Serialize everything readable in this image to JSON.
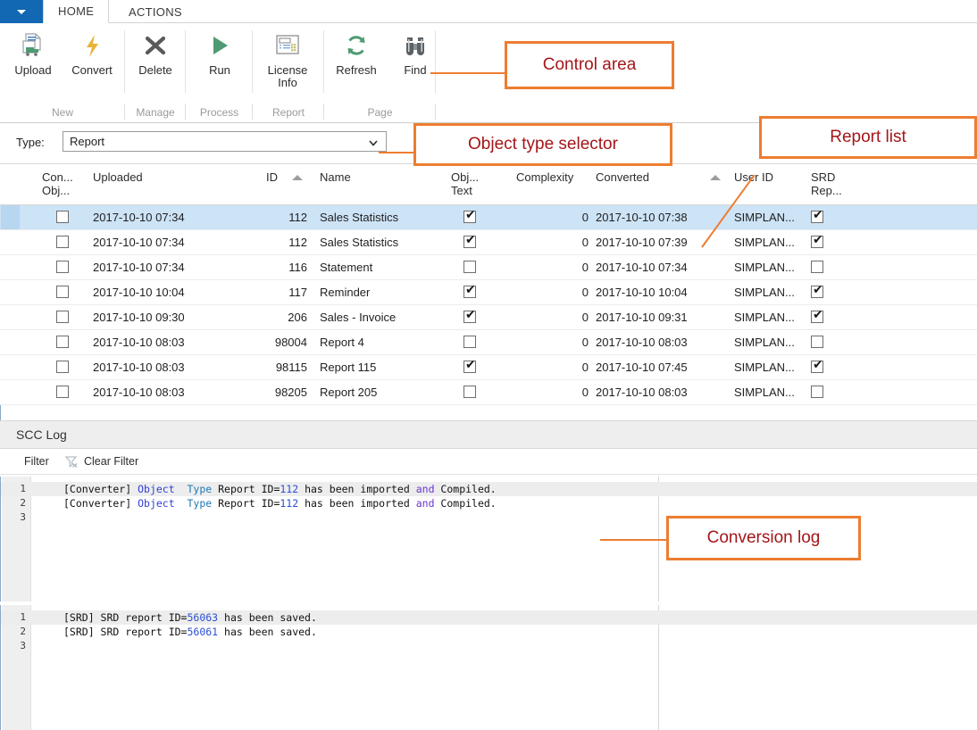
{
  "window": {
    "app_menu_icon": "chevron-down-icon",
    "tabs": [
      {
        "label": "HOME",
        "active": true
      },
      {
        "label": "ACTIONS",
        "active": false
      }
    ]
  },
  "ribbon": {
    "groups": [
      {
        "name": "New",
        "label": "New",
        "buttons": [
          {
            "label": "Upload",
            "icon": "upload-document-icon"
          },
          {
            "label": "Convert",
            "icon": "lightning-bolt-icon"
          }
        ]
      },
      {
        "name": "Manage",
        "label": "Manage",
        "buttons": [
          {
            "label": "Delete",
            "icon": "delete-x-icon"
          }
        ]
      },
      {
        "name": "Process",
        "label": "Process",
        "buttons": [
          {
            "label": "Run",
            "icon": "play-triangle-icon"
          }
        ]
      },
      {
        "name": "Report",
        "label": "Report",
        "buttons": [
          {
            "label": "License Info",
            "icon": "license-window-icon"
          }
        ]
      },
      {
        "name": "Page",
        "label": "Page",
        "buttons": [
          {
            "label": "Refresh",
            "icon": "refresh-circular-arrows-icon"
          },
          {
            "label": "Find",
            "icon": "binoculars-icon"
          }
        ]
      }
    ]
  },
  "type_selector": {
    "label": "Type:",
    "value": "Report",
    "placeholder": "Report",
    "dropdown_icon": "chevron-down-icon"
  },
  "grid": {
    "columns": [
      {
        "key": "converted_object",
        "header_line1": "Con...",
        "header_line2": "Obj..."
      },
      {
        "key": "uploaded",
        "header_line1": "Uploaded",
        "header_line2": ""
      },
      {
        "key": "id",
        "header_line1": "ID",
        "header_line2": "",
        "sorted": true
      },
      {
        "key": "name",
        "header_line1": "Name",
        "header_line2": ""
      },
      {
        "key": "object_text",
        "header_line1": "Obj...",
        "header_line2": "Text"
      },
      {
        "key": "complexity",
        "header_line1": "Complexity",
        "header_line2": ""
      },
      {
        "key": "converted",
        "header_line1": "Converted",
        "header_line2": "",
        "sorted": true
      },
      {
        "key": "user_id",
        "header_line1": "User ID",
        "header_line2": ""
      },
      {
        "key": "srd_report",
        "header_line1": "SRD",
        "header_line2": "Rep..."
      }
    ],
    "rows": [
      {
        "selected": true,
        "converted_object": false,
        "uploaded": "2017-10-10 07:34",
        "id": "112",
        "name": "Sales Statistics",
        "object_text": true,
        "complexity": "0",
        "converted": "2017-10-10 07:38",
        "user_id": "SIMPLAN...",
        "srd_report": true
      },
      {
        "selected": false,
        "converted_object": false,
        "uploaded": "2017-10-10 07:34",
        "id": "112",
        "name": "Sales Statistics",
        "object_text": true,
        "complexity": "0",
        "converted": "2017-10-10 07:39",
        "user_id": "SIMPLAN...",
        "srd_report": true
      },
      {
        "selected": false,
        "converted_object": false,
        "uploaded": "2017-10-10 07:34",
        "id": "116",
        "name": "Statement",
        "object_text": false,
        "complexity": "0",
        "converted": "2017-10-10 07:34",
        "user_id": "SIMPLAN...",
        "srd_report": false
      },
      {
        "selected": false,
        "converted_object": false,
        "uploaded": "2017-10-10 10:04",
        "id": "117",
        "name": "Reminder",
        "object_text": true,
        "complexity": "0",
        "converted": "2017-10-10 10:04",
        "user_id": "SIMPLAN...",
        "srd_report": true
      },
      {
        "selected": false,
        "converted_object": false,
        "uploaded": "2017-10-10 09:30",
        "id": "206",
        "name": "Sales - Invoice",
        "object_text": true,
        "complexity": "0",
        "converted": "2017-10-10 09:31",
        "user_id": "SIMPLAN...",
        "srd_report": true
      },
      {
        "selected": false,
        "converted_object": false,
        "uploaded": "2017-10-10 08:03",
        "id": "98004",
        "name": "Report 4",
        "object_text": false,
        "complexity": "0",
        "converted": "2017-10-10 08:03",
        "user_id": "SIMPLAN...",
        "srd_report": false
      },
      {
        "selected": false,
        "converted_object": false,
        "uploaded": "2017-10-10 08:03",
        "id": "98115",
        "name": "Report 115",
        "object_text": true,
        "complexity": "0",
        "converted": "2017-10-10 07:45",
        "user_id": "SIMPLAN...",
        "srd_report": true
      },
      {
        "selected": false,
        "converted_object": false,
        "uploaded": "2017-10-10 08:03",
        "id": "98205",
        "name": "Report 205",
        "object_text": false,
        "complexity": "0",
        "converted": "2017-10-10 08:03",
        "user_id": "SIMPLAN...",
        "srd_report": false
      }
    ]
  },
  "scc_log": {
    "title": "SCC Log",
    "filter_label": "Filter",
    "clear_filter_label": "Clear Filter",
    "clear_filter_icon": "funnel-clear-icon",
    "panels": [
      {
        "name": "converter-log",
        "lines": [
          {
            "number": "1",
            "segments": [
              {
                "t": "[Converter] ",
                "c": "plain"
              },
              {
                "t": "Object",
                "c": "kw-b"
              },
              {
                "t": "  ",
                "c": "plain"
              },
              {
                "t": "Type",
                "c": "kw-c"
              },
              {
                "t": " Report ID=",
                "c": "plain"
              },
              {
                "t": "112",
                "c": "kw-n"
              },
              {
                "t": " has been imported ",
                "c": "plain"
              },
              {
                "t": "and",
                "c": "kw-p"
              },
              {
                "t": " Compiled.",
                "c": "plain"
              }
            ]
          },
          {
            "number": "2",
            "segments": [
              {
                "t": "[Converter] ",
                "c": "plain"
              },
              {
                "t": "Object",
                "c": "kw-b"
              },
              {
                "t": "  ",
                "c": "plain"
              },
              {
                "t": "Type",
                "c": "kw-c"
              },
              {
                "t": " Report ID=",
                "c": "plain"
              },
              {
                "t": "112",
                "c": "kw-n"
              },
              {
                "t": " has been imported ",
                "c": "plain"
              },
              {
                "t": "and",
                "c": "kw-p"
              },
              {
                "t": " Compiled.",
                "c": "plain"
              }
            ]
          },
          {
            "number": "3",
            "segments": []
          }
        ]
      },
      {
        "name": "srd-log",
        "lines": [
          {
            "number": "1",
            "segments": [
              {
                "t": "[SRD] SRD report ID=",
                "c": "plain"
              },
              {
                "t": "56063",
                "c": "kw-n"
              },
              {
                "t": " has been saved.",
                "c": "plain"
              }
            ]
          },
          {
            "number": "2",
            "segments": [
              {
                "t": "[SRD] SRD report ID=",
                "c": "plain"
              },
              {
                "t": "56061",
                "c": "kw-n"
              },
              {
                "t": " has been saved.",
                "c": "plain"
              }
            ]
          },
          {
            "number": "3",
            "segments": []
          }
        ]
      }
    ]
  },
  "annotations": [
    {
      "name": "control-area",
      "text": "Control area"
    },
    {
      "name": "object-type-selector",
      "text": "Object type selector"
    },
    {
      "name": "report-list",
      "text": "Report list"
    },
    {
      "name": "conversion-log",
      "text": "Conversion log"
    }
  ],
  "colors": {
    "accent_blue": "#1268b3",
    "selection_blue": "#cde3f6",
    "annotation_border": "#ed7d31",
    "annotation_text": "#a4161a",
    "icon_green": "#4e9a72",
    "icon_gold": "#e8b33a"
  }
}
